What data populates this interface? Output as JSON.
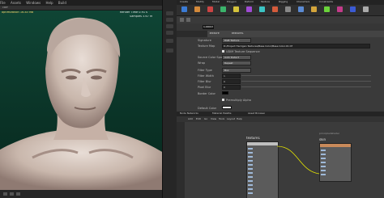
{
  "menubar": {
    "items": [
      "File",
      "Assets",
      "Windows",
      "Help",
      "Build"
    ]
  },
  "viewport": {
    "persp_label": "persp1",
    "camera_label": "cam",
    "render_status": "Render Time 0.91 s",
    "render_samples": "Samples 3.67 M",
    "stats_left": "optimization 16.83 MB"
  },
  "shelf": {
    "tabs": [
      "Create",
      "Modify",
      "Model",
      "Polygon",
      "Deform",
      "Texture",
      "Rigging",
      "Characters",
      "Constraints"
    ],
    "icons": [
      "#3b7bd4",
      "#d48a3b",
      "#c44",
      "#3bb46b",
      "#d4c33b",
      "#a04bd4",
      "#3bc4c4",
      "#d45b3b",
      "#888",
      "#5b8bd4",
      "#d4a53b",
      "#6bd43b",
      "#c43b8a",
      "#3b5bd4",
      "#aaa"
    ]
  },
  "params": {
    "node_type": "Texture",
    "node_name": "texture1",
    "dimension_value": "1.00017",
    "rows": [
      {
        "label": "Signature",
        "value": "RGB Texture"
      },
      {
        "label": "Texture Map",
        "value": "D:/Project Harrigan Textures/Base Color/Base Color.01.tif"
      },
      {
        "label": "",
        "value": "UDIM Texture Sequence"
      },
      {
        "label": "Source Color Space",
        "value": "Auto Detect"
      },
      {
        "label": "Wrap",
        "value": "Repeat"
      },
      {
        "label": "Filter Type",
        "value": "Box"
      },
      {
        "label": "Filter Width",
        "value": "1"
      },
      {
        "label": "Filter Blur",
        "value": "0"
      },
      {
        "label": "Pixel Blur",
        "value": "0"
      },
      {
        "label": "Border Color",
        "value": ""
      },
      {
        "label": "",
        "value": "Premultiply Alpha"
      },
      {
        "label": "Default Color",
        "value": ""
      }
    ]
  },
  "network": {
    "tabs": [
      "Node Networks",
      "Material Palette",
      "Asset Browser"
    ],
    "menu": [
      "Add",
      "Edit",
      "Go",
      "View",
      "Tools",
      "Layout",
      "Help"
    ],
    "node_texture": "texture1",
    "node_skin": "skin",
    "node_skin_sub": "principledshader"
  }
}
